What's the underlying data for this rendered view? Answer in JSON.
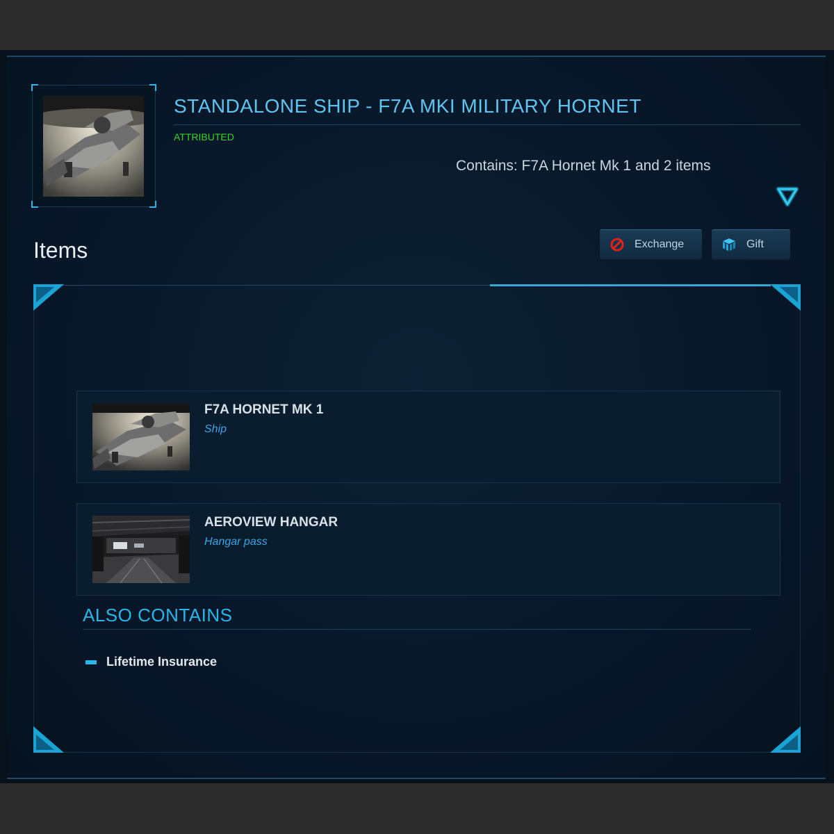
{
  "header": {
    "title": "STANDALONE SHIP - F7A MKI MILITARY HORNET",
    "status": "ATTRIBUTED",
    "contains": "Contains: F7A Hornet Mk 1 and 2 items",
    "thumbnail_icon": "hornet-ship-thumbnail",
    "expand_icon": "triangle-down-icon"
  },
  "items_section": {
    "title": "Items",
    "buttons": {
      "exchange_label": "Exchange",
      "exchange_icon": "no-entry-icon",
      "gift_label": "Gift",
      "gift_icon": "gift-box-icon"
    },
    "items": [
      {
        "name": "F7A HORNET MK 1",
        "type": "Ship",
        "thumbnail": "hornet-ship-image"
      },
      {
        "name": "AEROVIEW HANGAR",
        "type": "Hangar pass",
        "thumbnail": "hangar-interior-image"
      }
    ]
  },
  "also_contains": {
    "title": "ALSO CONTAINS",
    "items": [
      "Lifetime Insurance"
    ]
  },
  "colors": {
    "accent": "#29b6e8",
    "title": "#5fc4ee",
    "status_green": "#39d626",
    "item_type": "#3aa6e6",
    "background": "#08182a"
  }
}
